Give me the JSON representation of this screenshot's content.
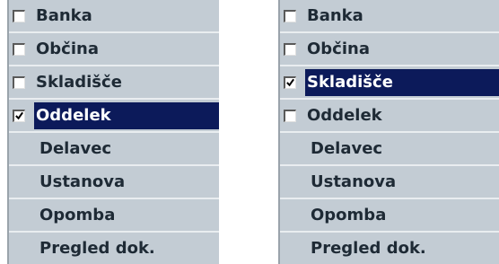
{
  "left_panel": {
    "items": [
      {
        "label": "Banka",
        "has_checkbox": true,
        "checked": false,
        "selected": false
      },
      {
        "label": "Občina",
        "has_checkbox": true,
        "checked": false,
        "selected": false
      },
      {
        "label": "Skladišče",
        "has_checkbox": true,
        "checked": false,
        "selected": false
      },
      {
        "label": "Oddelek",
        "has_checkbox": true,
        "checked": true,
        "selected": true
      },
      {
        "label": "Delavec",
        "has_checkbox": false,
        "checked": false,
        "selected": false
      },
      {
        "label": "Ustanova",
        "has_checkbox": false,
        "checked": false,
        "selected": false
      },
      {
        "label": "Opomba",
        "has_checkbox": false,
        "checked": false,
        "selected": false
      },
      {
        "label": "Pregled dok.",
        "has_checkbox": false,
        "checked": false,
        "selected": false
      }
    ]
  },
  "right_panel": {
    "items": [
      {
        "label": "Banka",
        "has_checkbox": true,
        "checked": false,
        "selected": false
      },
      {
        "label": "Občina",
        "has_checkbox": true,
        "checked": false,
        "selected": false
      },
      {
        "label": "Skladišče",
        "has_checkbox": true,
        "checked": true,
        "selected": true
      },
      {
        "label": "Oddelek",
        "has_checkbox": true,
        "checked": false,
        "selected": false
      },
      {
        "label": "Delavec",
        "has_checkbox": false,
        "checked": false,
        "selected": false
      },
      {
        "label": "Ustanova",
        "has_checkbox": false,
        "checked": false,
        "selected": false
      },
      {
        "label": "Opomba",
        "has_checkbox": false,
        "checked": false,
        "selected": false
      },
      {
        "label": "Pregled dok.",
        "has_checkbox": false,
        "checked": false,
        "selected": false
      }
    ]
  },
  "colors": {
    "panel_bg": "#c3ccd4",
    "selection_bg": "#0c1a5a",
    "label_text": "#1e2a35"
  }
}
